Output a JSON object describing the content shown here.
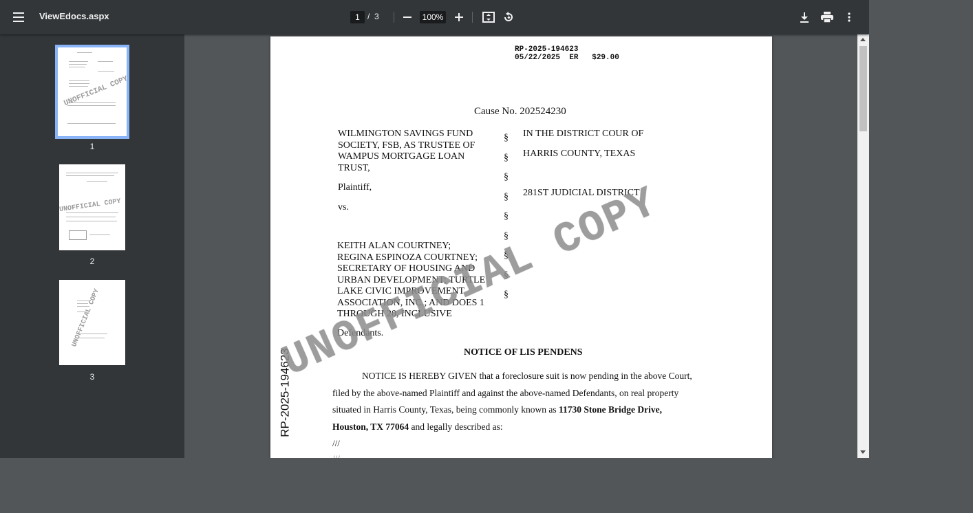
{
  "toolbar": {
    "title": "ViewEdocs.aspx",
    "page_current": "1",
    "page_separator": "/",
    "page_total": "3",
    "zoom": "100%"
  },
  "sidebar": {
    "thumbnails": [
      {
        "label": "1",
        "selected": true
      },
      {
        "label": "2",
        "selected": false
      },
      {
        "label": "3",
        "selected": false
      }
    ],
    "watermark_text": "UNOFFICIAL COPY"
  },
  "document": {
    "record_number": "RP-2025-194623",
    "record_line2": "05/22/2025  ER   $29.00",
    "cause": "Cause No. 202524230",
    "plaintiff_lines": [
      "WILMINGTON SAVINGS FUND",
      "SOCIETY, FSB, AS TRUSTEE OF",
      "WAMPUS MORTGAGE LOAN",
      "TRUST,"
    ],
    "plaintiff_label": "Plaintiff,",
    "vs": "vs.",
    "defendant_lines": [
      "KEITH ALAN COURTNEY;",
      "REGINA ESPINOZA COURTNEY;",
      "SECRETARY OF HOUSING AND",
      "URBAN DEVELOPMENT; TURTLE",
      "LAKE CIVIC IMPROVEMENT",
      "ASSOCIATION, INC.; AND DOES 1",
      "THROUGH 20, INCLUSIVE"
    ],
    "defendants_label": "Defendants.",
    "section_symbol": "§",
    "court_line1": "IN THE DISTRICT COUR OF",
    "court_line2": "HARRIS COUNTY, TEXAS",
    "court_line3": "281ST JUDICIAL DISTRICT",
    "notice_title": "NOTICE OF LIS PENDENS",
    "body_line1": "NOTICE IS HEREBY GIVEN that a foreclosure suit is now pending in the above Court,",
    "body_line2": "filed by the above-named Plaintiff and against the above-named Defendants, on real property",
    "body_line3_pre": "situated in Harris County, Texas, being commonly known as ",
    "body_line3_bold": "11730 Stone Bridge Drive,",
    "body_line4_bold": "Houston, TX 77064",
    "body_line4_post": " and legally described as:",
    "slashes": "///",
    "side_stamp": "RP-2025-194623",
    "watermark": "UNOFFICIAL COPY"
  },
  "colors": {
    "toolbar_bg": "#323639",
    "viewer_bg": "#525659",
    "selected_thumb_border": "#8ab4f8",
    "watermark": "#8c8c8c"
  }
}
